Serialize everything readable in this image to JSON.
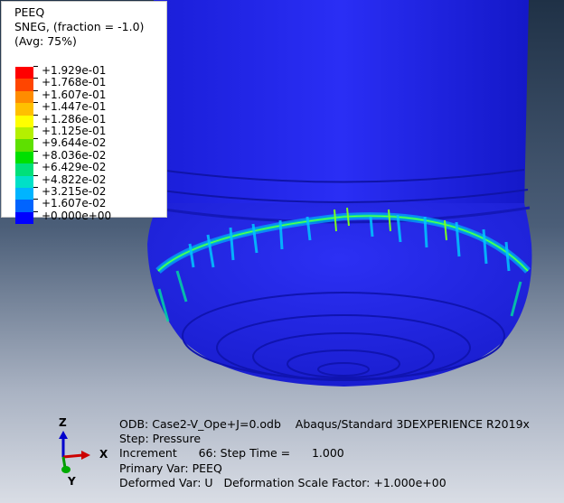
{
  "legend": {
    "variable": "PEEQ",
    "section": "SNEG, (fraction = -1.0)",
    "averaging": "(Avg: 75%)",
    "levels": [
      {
        "label": "+1.929e-01",
        "color": "#ff0000"
      },
      {
        "label": "+1.768e-01",
        "color": "#ff4500"
      },
      {
        "label": "+1.607e-01",
        "color": "#ff8c00"
      },
      {
        "label": "+1.447e-01",
        "color": "#ffc000"
      },
      {
        "label": "+1.286e-01",
        "color": "#ffff00"
      },
      {
        "label": "+1.125e-01",
        "color": "#b4f000"
      },
      {
        "label": "+9.644e-02",
        "color": "#5ee000"
      },
      {
        "label": "+8.036e-02",
        "color": "#00e000"
      },
      {
        "label": "+6.429e-02",
        "color": "#00e07a"
      },
      {
        "label": "+4.822e-02",
        "color": "#00e0c8"
      },
      {
        "label": "+3.215e-02",
        "color": "#00b4ff"
      },
      {
        "label": "+1.607e-02",
        "color": "#0064ff"
      },
      {
        "label": "+0.000e+00",
        "color": "#0000ff"
      }
    ],
    "min_label": "+0.000e+00"
  },
  "info": {
    "odb": "ODB: Case2-V_Ope+J=0.odb    Abaqus/Standard 3DEXPERIENCE R2019x",
    "step": "Step: Pressure",
    "increment": "Increment      66: Step Time =      1.000",
    "primary_var": "Primary Var: PEEQ",
    "deformed_var": "Deformed Var: U   Deformation Scale Factor: +1.000e+00"
  },
  "triad": {
    "z": "Z",
    "x": "X",
    "y": "Y"
  }
}
